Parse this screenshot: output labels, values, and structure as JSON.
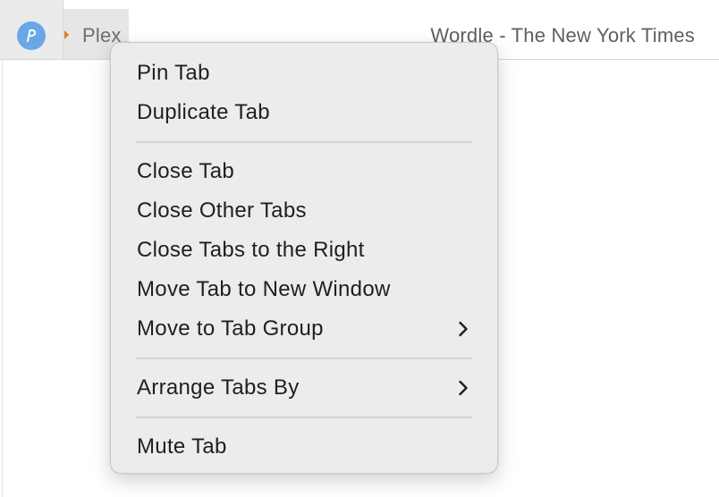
{
  "tabs": {
    "pinned": {
      "icon": "pen-logo-icon",
      "accent": "#6aa7e6"
    },
    "plex": {
      "label": "Plex",
      "audio_icon": "audio-playing-icon",
      "accent": "#e07b1f"
    },
    "wordle": {
      "label": "Wordle - The New York Times"
    }
  },
  "context_menu": {
    "groups": [
      [
        {
          "label": "Pin Tab"
        },
        {
          "label": "Duplicate Tab"
        }
      ],
      [
        {
          "label": "Close Tab"
        },
        {
          "label": "Close Other Tabs"
        },
        {
          "label": "Close Tabs to the Right"
        },
        {
          "label": "Move Tab to New Window"
        },
        {
          "label": "Move to Tab Group",
          "submenu": true
        }
      ],
      [
        {
          "label": "Arrange Tabs By",
          "submenu": true
        }
      ],
      [
        {
          "label": "Mute Tab"
        }
      ]
    ]
  }
}
